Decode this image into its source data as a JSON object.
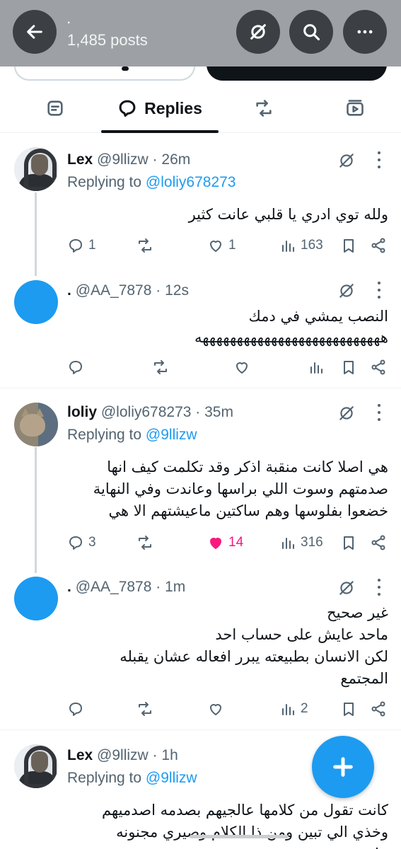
{
  "header": {
    "title": "·",
    "post_count": "1,485 posts"
  },
  "tabs": {
    "replies_label": "Replies"
  },
  "tweets": [
    {
      "name": "Lex",
      "handle": "@9llizw",
      "time": "26m",
      "replying_prefix": "Replying to",
      "replying_to": "@loliy678273",
      "text": "ولله توي ادري يا قلبي عانت كثير",
      "replies": "1",
      "retweets": "",
      "likes": "1",
      "views": "163"
    },
    {
      "name": ".",
      "handle": "@AA_7878",
      "time": "12s",
      "text_lines": [
        "النصب يمشي في دمك",
        "هههههههههههههههههههههههههههه"
      ],
      "replies": "",
      "retweets": "",
      "likes": "",
      "views": ""
    },
    {
      "name": "loliy",
      "handle": "@loliy678273",
      "time": "35m",
      "replying_prefix": "Replying to",
      "replying_to": "@9llizw",
      "text_lines": [
        "هي اصلا كانت منقبة اذكر وقد تكلمت كيف انها",
        "صدمتهم وسوت اللي براسها وعاندت وفي النهاية",
        "خضعوا بفلوسها وهم ساكتين ماعيشتهم الا هي"
      ],
      "replies": "3",
      "retweets": "",
      "likes": "14",
      "views": "316"
    },
    {
      "name": ".",
      "handle": "@AA_7878",
      "time": "1m",
      "text_lines": [
        "غير صحيح",
        "ماحد عايش على حساب احد",
        "لكن الانسان بطبيعته يبرر افعاله عشان يقبله",
        "المجتمع"
      ],
      "replies": "",
      "retweets": "",
      "likes": "",
      "views": "2"
    },
    {
      "name": "Lex",
      "handle": "@9llizw",
      "time": "1h",
      "replying_prefix": "Replying to",
      "replying_to": "@9llizw",
      "text_lines": [
        "كانت تقول من كلامها عالجيهم بصدمه اصدميهم",
        "وخذي الي تبين ومن ذا الكلام وصيري مجنونه عليهم"
      ]
    }
  ],
  "colors": {
    "accent": "#1d9bf0",
    "like": "#f91880",
    "muted": "#536471",
    "header_bg": "#9da1a5"
  },
  "icons": {
    "back": "arrow-left-icon",
    "mute": "mute-icon",
    "search": "search-icon",
    "more": "more-icon",
    "compose": "plus-icon"
  }
}
